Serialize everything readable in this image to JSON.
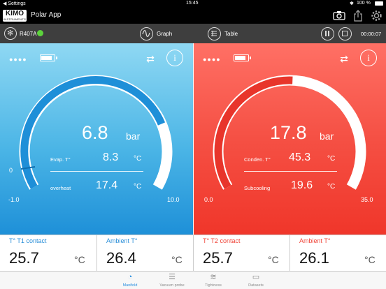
{
  "status_bar": {
    "back_label": "◀ Settings",
    "time": "15:45",
    "battery": "100 %"
  },
  "app": {
    "logo": "KIMO",
    "logo_sub": "INSTRUMENTS",
    "title": "Polar App"
  },
  "toolbar": {
    "refrigerant": "R407A",
    "graph_label": "Graph",
    "table_label": "Table",
    "timer": "00:00:07"
  },
  "left_panel": {
    "main_value": "6.8",
    "main_unit": "bar",
    "row1_label": "Evap. T°",
    "row1_value": "8.3",
    "row1_unit": "°C",
    "row2_label": "overheat",
    "row2_value": "17.4",
    "row2_unit": "°C",
    "scale_min": "-1.0",
    "scale_max": "10.0",
    "zero_mark": "0",
    "gauge_fraction": 0.78
  },
  "right_panel": {
    "main_value": "17.8",
    "main_unit": "bar",
    "row1_label": "Conden. T°",
    "row1_value": "45.3",
    "row1_unit": "°C",
    "row2_label": "Subcooling",
    "row2_value": "19.6",
    "row2_unit": "°C",
    "scale_min": "0.0",
    "scale_max": "35.0",
    "gauge_fraction": 0.51
  },
  "readings": [
    {
      "label": "T° T1 contact",
      "value": "25.7",
      "unit": "°C",
      "color": "#2b8fd8"
    },
    {
      "label": "Ambient T°",
      "value": "26.4",
      "unit": "°C",
      "color": "#2b8fd8"
    },
    {
      "label": "T° T2 contact",
      "value": "25.7",
      "unit": "°C",
      "color": "#f0463a"
    },
    {
      "label": "Ambient T°",
      "value": "26.1",
      "unit": "°C",
      "color": "#f0463a"
    }
  ],
  "tabs": [
    {
      "label": "Manifold",
      "icon": "gauge-icon",
      "active": true
    },
    {
      "label": "Vacuum probe",
      "icon": "probe-icon",
      "active": false
    },
    {
      "label": "Tightness",
      "icon": "wind-icon",
      "active": false
    },
    {
      "label": "Datasets",
      "icon": "folder-icon",
      "active": false
    }
  ],
  "colors": {
    "left_accent": "#1e90d8",
    "right_accent": "#f0362a",
    "tab_active": "#2a8fe0"
  }
}
